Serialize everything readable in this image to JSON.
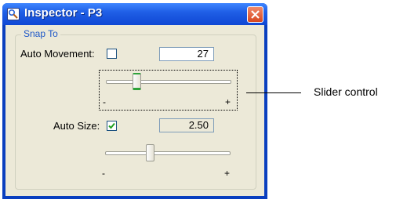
{
  "window": {
    "title": "Inspector - P3"
  },
  "group": {
    "title": "Snap To"
  },
  "auto_movement": {
    "label": "Auto Movement:",
    "checked": false,
    "value": "27",
    "slider_min_label": "-",
    "slider_max_label": "+",
    "slider_value_fraction": 0.25
  },
  "auto_size": {
    "label": "Auto Size:",
    "checked": true,
    "value": "2.50",
    "slider_min_label": "-",
    "slider_max_label": "+",
    "slider_value_fraction": 0.37
  },
  "callout": {
    "text": "Slider control"
  },
  "colors": {
    "titlebar": "#1f5fe6",
    "dialog_bg": "#ece9d8",
    "group_title": "#1d57c8",
    "thumb_highlight": "#2ea23a",
    "close_button": "#d7461f"
  },
  "icons": [
    "inspector-icon",
    "close-icon",
    "checkmark-icon"
  ]
}
